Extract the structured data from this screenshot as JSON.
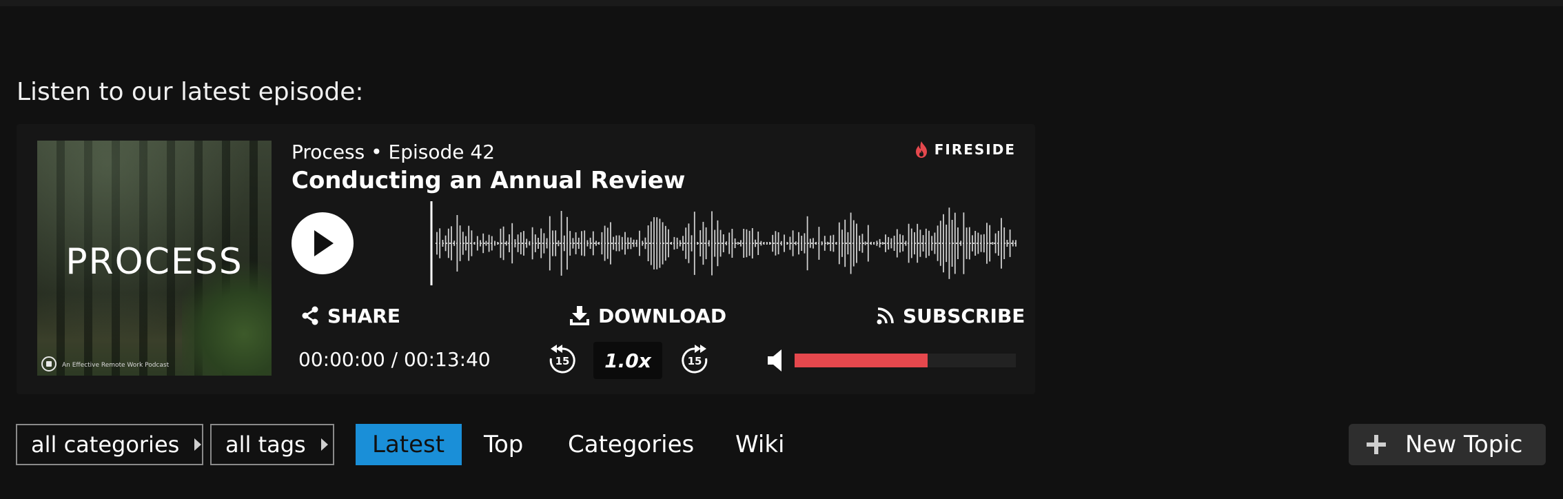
{
  "intro_heading": "Listen to our latest episode:",
  "player": {
    "cover": {
      "title": "PROCESS",
      "caption": "An Effective Remote Work Podcast"
    },
    "show_line": "Process • Episode 42",
    "episode_title": "Conducting an Annual Review",
    "brand": "FIRESIDE",
    "actions": {
      "share": "SHARE",
      "download": "DOWNLOAD",
      "subscribe": "SUBSCRIBE"
    },
    "timecode": "00:00:00 / 00:13:40",
    "skip_back_seconds": "15",
    "skip_forward_seconds": "15",
    "speed": "1.0x",
    "volume_level": 0.6,
    "playback_progress": 0,
    "colors": {
      "accent": "#e5484d",
      "background": "#161616"
    },
    "icons": {
      "play": "play-icon",
      "share": "share-icon",
      "download": "download-icon",
      "subscribe": "rss-icon",
      "brand": "flame-icon",
      "volume": "speaker-icon",
      "skip_back": "rewind-15-icon",
      "skip_forward": "forward-15-icon"
    }
  },
  "filters": {
    "categories": "all categories",
    "tags": "all tags"
  },
  "nav": {
    "items": [
      "Latest",
      "Top",
      "Categories",
      "Wiki"
    ],
    "active": "Latest",
    "active_color": "#1a8fd8"
  },
  "new_topic_label": "New Topic"
}
